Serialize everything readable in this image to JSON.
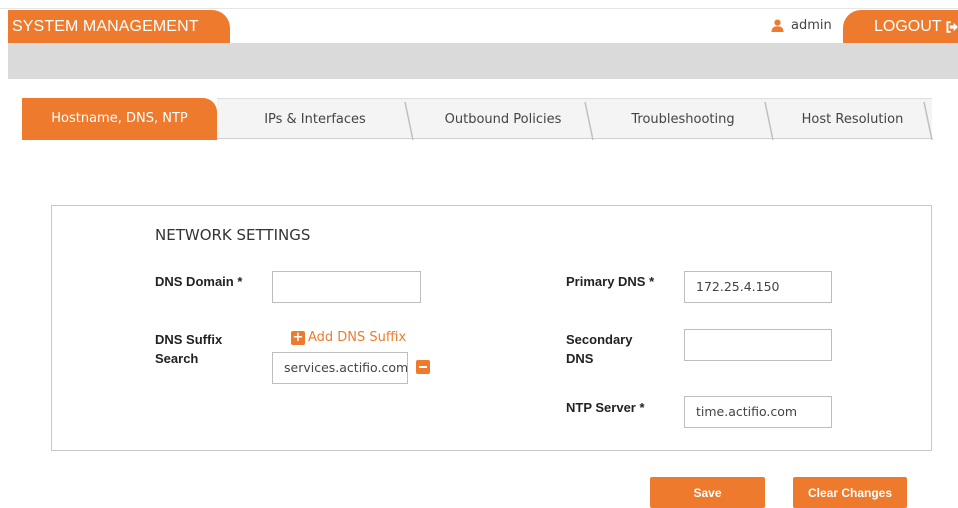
{
  "header": {
    "title": "SYSTEM MANAGEMENT",
    "user": "admin",
    "logout_label": "LOGOUT",
    "accent_color": "#ee7b2d",
    "user_icon": "user-icon",
    "logout_icon": "sign-out-icon"
  },
  "tabs": [
    {
      "label": "Hostname, DNS, NTP",
      "active": true
    },
    {
      "label": "IPs & Interfaces",
      "active": false
    },
    {
      "label": "Outbound Policies",
      "active": false
    },
    {
      "label": "Troubleshooting",
      "active": false
    },
    {
      "label": "Host Resolution",
      "active": false
    }
  ],
  "network": {
    "title": "NETWORK SETTINGS",
    "dns_domain": {
      "label": "DNS Domain *",
      "value": ""
    },
    "dns_suffix": {
      "label": "DNS Suffix Search",
      "add_label": "Add DNS Suffix",
      "add_icon": "plus-square-icon",
      "remove_icon": "minus-square-icon",
      "value": "services.actifio.com"
    },
    "primary_dns": {
      "label": "Primary DNS *",
      "value": "172.25.4.150"
    },
    "secondary_dns": {
      "label": "Secondary DNS",
      "value": ""
    },
    "ntp_server": {
      "label": "NTP Server *",
      "value": "time.actifio.com"
    }
  },
  "actions": {
    "save_label": "Save",
    "clear_label": "Clear Changes"
  }
}
